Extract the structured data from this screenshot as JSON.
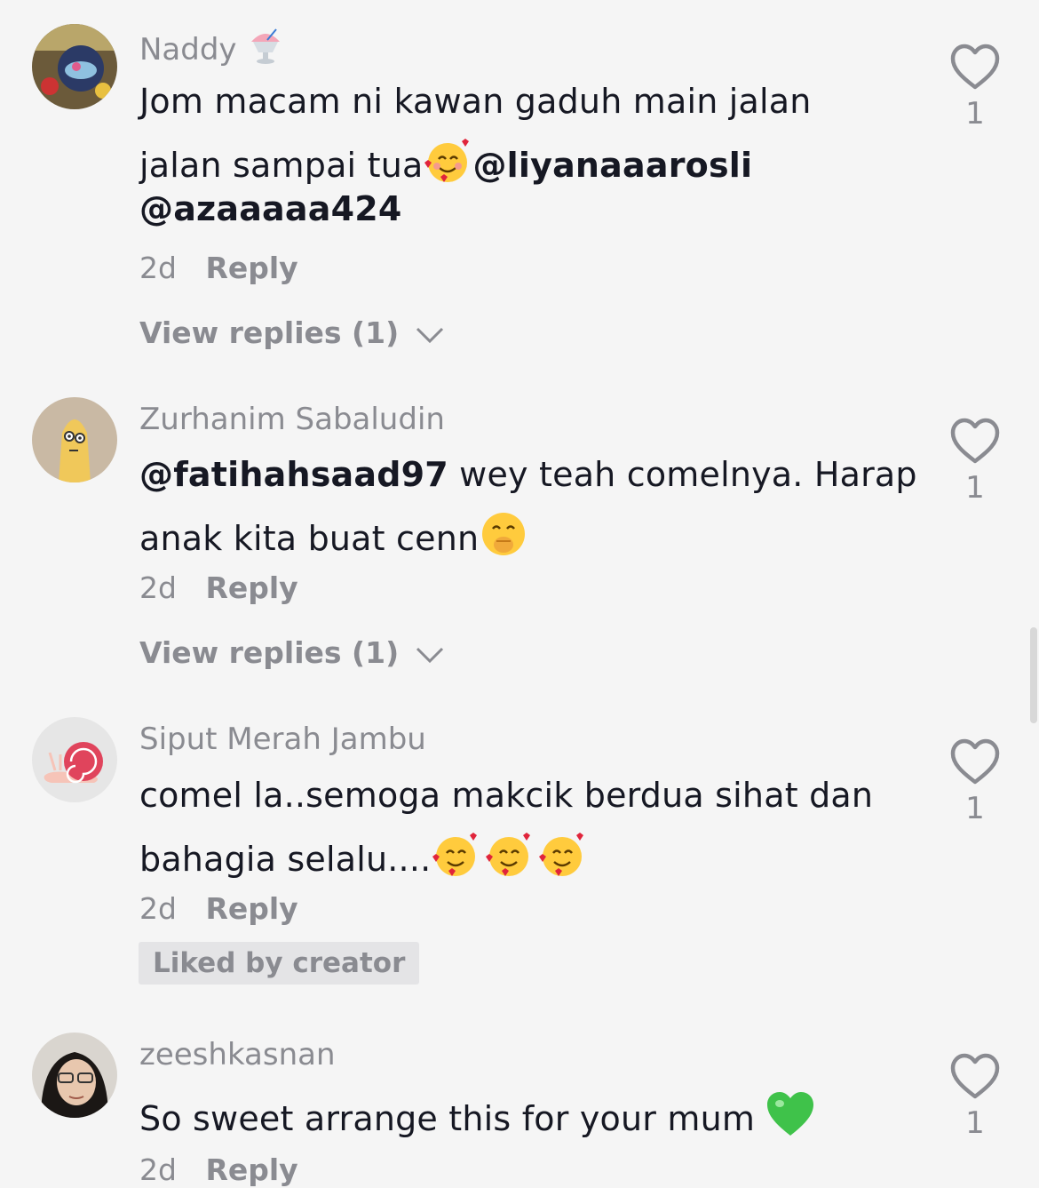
{
  "comments": [
    {
      "username": "Naddy",
      "username_emoji": "shaved-ice-emoji",
      "lines": [
        {
          "text": "Jom macam ni kawan gaduh main jalan",
          "mention": ""
        },
        {
          "text": "jalan sampai tua",
          "emoji": "smiling-face-with-hearts",
          "mention": "@liyanaaarosli"
        },
        {
          "text": "",
          "mention": "@azaaaaa424"
        }
      ],
      "time": "2d",
      "reply_label": "Reply",
      "view_replies": "View replies (1)",
      "likes": "1"
    },
    {
      "username": "Zurhanim Sabaludin",
      "lines": [
        {
          "mention": "@fatihahsaad97",
          "text": " wey teah comelnya. Harap"
        },
        {
          "text": "anak kita buat cenn",
          "emoji": "face-with-hand-over-mouth"
        }
      ],
      "time": "2d",
      "reply_label": "Reply",
      "view_replies": "View replies (1)",
      "likes": "1"
    },
    {
      "username": "Siput Merah Jambu",
      "lines": [
        {
          "text": "comel la..semoga makcik berdua sihat dan"
        },
        {
          "text": "bahagia selalu....",
          "emoji": "smiling-face-with-hearts x3"
        }
      ],
      "time": "2d",
      "reply_label": "Reply",
      "badge": "Liked by creator",
      "likes": "1"
    },
    {
      "username": "zeeshkasnan",
      "lines": [
        {
          "text": "So sweet arrange this for your mum ",
          "emoji": "green-heart"
        }
      ],
      "time": "2d",
      "reply_label": "Reply",
      "likes": "1"
    }
  ],
  "icons": {
    "like": "heart-outline-icon",
    "expand": "chevron-down-icon"
  },
  "colors": {
    "background": "#f5f5f5",
    "text": "#161823",
    "secondary": "#8a8b91",
    "badge_bg": "#e4e4e6"
  }
}
